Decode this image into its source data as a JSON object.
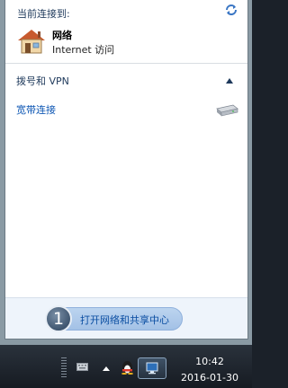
{
  "flyout": {
    "header": "当前连接到:",
    "network": {
      "name": "网络",
      "status": "Internet 访问"
    },
    "section_title": "拨号和 VPN",
    "connection_link": "宽带连接",
    "footer": {
      "step": "1",
      "link": "打开网络和共享中心"
    }
  },
  "taskbar": {
    "time": "10:42",
    "date": "2016-01-30"
  },
  "icons": {
    "refresh": "refresh-icon",
    "network": "home-network-icon",
    "collapse": "chevron-up-icon",
    "dialup": "dialup-modem-icon",
    "keyboard": "keyboard-icon",
    "tray_expand": "triangle-up-icon",
    "tray_app": "penguin-icon",
    "network_tray": "network-monitor-icon"
  },
  "colors": {
    "link": "#0b55b3",
    "header": "#1e395b",
    "footer_bg": "#eef4fb"
  }
}
